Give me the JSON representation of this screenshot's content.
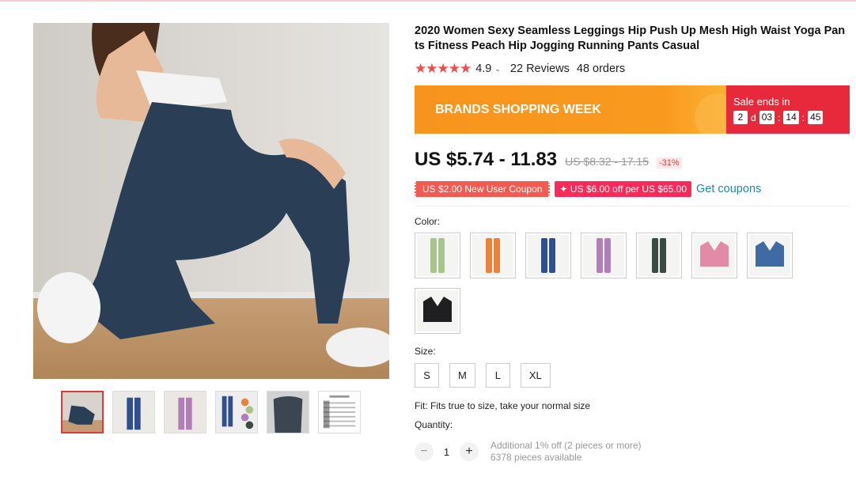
{
  "product": {
    "title": "2020 Women Sexy Seamless Leggings Hip Push Up Mesh High Waist Yoga Pants Fitness Peach Hip Jogging Running Pants Casual",
    "stars": "★★★★★",
    "rating": "4.9",
    "reviews": "22 Reviews",
    "orders": "48 orders"
  },
  "promo": {
    "banner_text": "BRANDS SHOPPING WEEK",
    "sale_label": "Sale ends in",
    "days": "2",
    "days_unit": "d",
    "hours": "03",
    "minutes": "14",
    "seconds": "45"
  },
  "price": {
    "current": "US $5.74 - 11.83",
    "original": "US $8.32 - 17.15",
    "discount": "-31%"
  },
  "coupons": {
    "new_user": "US $2.00 New User Coupon",
    "store": "✦ US $6.00 off per US $65.00",
    "get_link": "Get coupons"
  },
  "options": {
    "color_label": "Color:",
    "colors": [
      {
        "name": "green-leggings",
        "color": "#a9c48a"
      },
      {
        "name": "orange-leggings",
        "color": "#e9823b"
      },
      {
        "name": "blue-leggings",
        "color": "#2f4f8f"
      },
      {
        "name": "purple-leggings",
        "color": "#b07fb8"
      },
      {
        "name": "dark-green-leggings",
        "color": "#3a4b44"
      },
      {
        "name": "pink-bra",
        "color": "#e38aa8"
      },
      {
        "name": "blue-bra",
        "color": "#3f6aa3"
      },
      {
        "name": "black-bra",
        "color": "#1f1f22"
      }
    ],
    "size_label": "Size:",
    "sizes": [
      "S",
      "M",
      "L",
      "XL"
    ],
    "fit": "Fit: Fits true to size, take your normal size"
  },
  "quantity": {
    "label": "Quantity:",
    "minus": "−",
    "value": "1",
    "plus": "+",
    "discount_note": "Additional 1% off (2 pieces or more)",
    "available": "6378 pieces available"
  },
  "gallery": {
    "thumbs": [
      "thumb-dark-leggings",
      "thumb-blue-leggings",
      "thumb-purple-leggings",
      "thumb-multi-color",
      "thumb-gray-leggings",
      "thumb-size-chart"
    ]
  }
}
